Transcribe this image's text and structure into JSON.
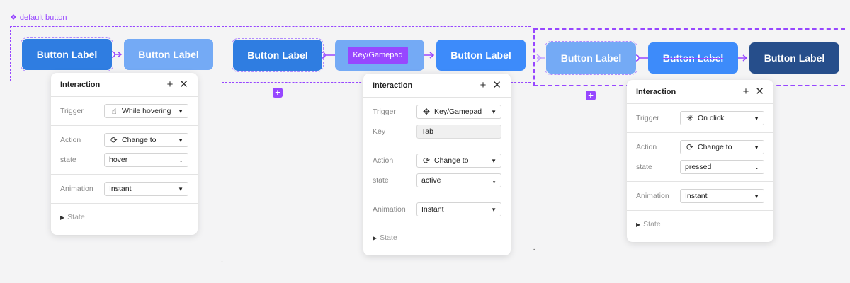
{
  "component_set": {
    "label": "default button",
    "icon": "diamond-grid-icon",
    "accent": "#9747ff"
  },
  "buttons": [
    {
      "label": "Button Label",
      "state": "default"
    },
    {
      "label": "Button Label",
      "state": "hover"
    },
    {
      "label": "Button Label",
      "state": "default"
    },
    {
      "label": "Button Label",
      "state": "hover"
    },
    {
      "label": "Button Label",
      "state": "active"
    },
    {
      "label": "Button Label",
      "state": "hover"
    },
    {
      "label": "Button Label",
      "state": "active"
    },
    {
      "label": "Button Label",
      "state": "pressed"
    }
  ],
  "trigger_chip": "Key/Gamepad",
  "colors": {
    "default": "#2f7de1",
    "hover": "#74aaf5",
    "active": "#3d8bfa",
    "pressed": "#264e8b"
  },
  "panels": [
    {
      "title": "Interaction",
      "trigger": {
        "label": "Trigger",
        "value": "While hovering",
        "icon": "hover-hand-icon"
      },
      "action": {
        "label": "Action",
        "value": "Change to",
        "icon": "refresh-icon"
      },
      "state": {
        "label": "state",
        "value": "hover"
      },
      "animation": {
        "label": "Animation",
        "value": "Instant"
      },
      "footer": "State"
    },
    {
      "title": "Interaction",
      "trigger": {
        "label": "Trigger",
        "value": "Key/Gamepad",
        "icon": "gamepad-icon"
      },
      "key": {
        "label": "Key",
        "value": "Tab"
      },
      "action": {
        "label": "Action",
        "value": "Change to",
        "icon": "refresh-icon"
      },
      "state": {
        "label": "state",
        "value": "active"
      },
      "animation": {
        "label": "Animation",
        "value": "Instant"
      },
      "footer": "State"
    },
    {
      "title": "Interaction",
      "trigger": {
        "label": "Trigger",
        "value": "On click",
        "icon": "click-icon"
      },
      "action": {
        "label": "Action",
        "value": "Change to",
        "icon": "refresh-icon"
      },
      "state": {
        "label": "state",
        "value": "pressed"
      },
      "animation": {
        "label": "Animation",
        "value": "Instant"
      },
      "footer": "State"
    }
  ]
}
